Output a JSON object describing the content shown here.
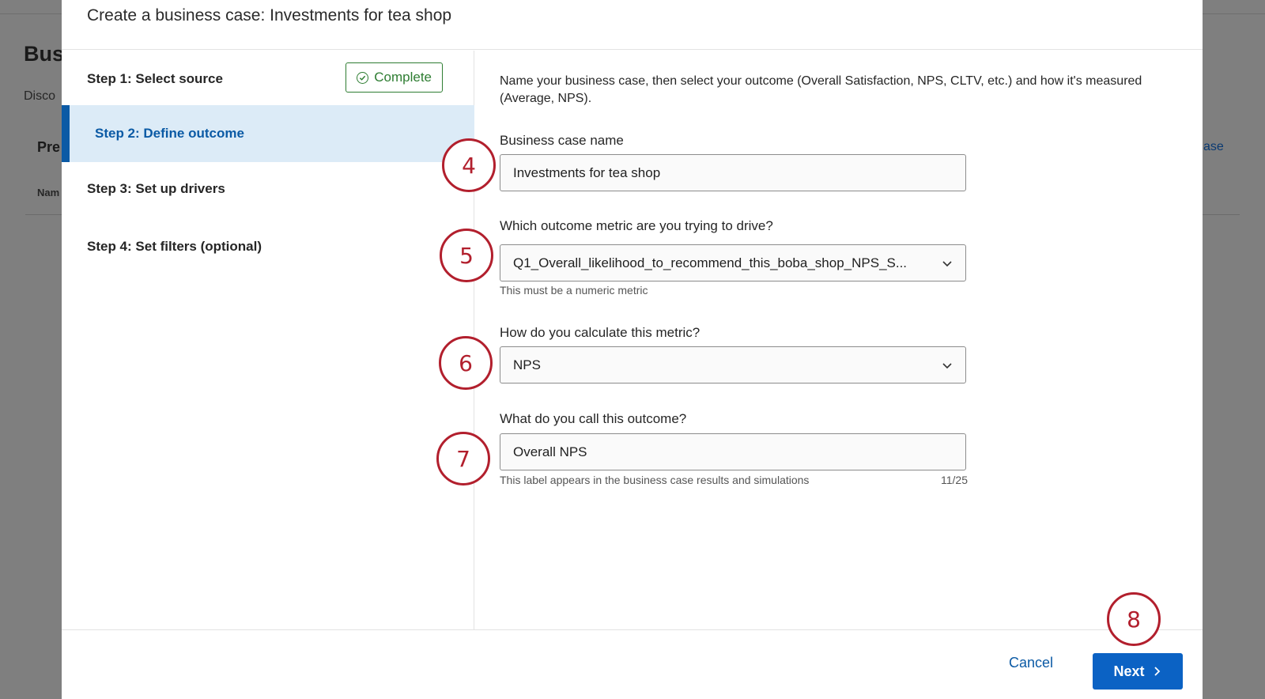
{
  "background": {
    "title": "Bus",
    "description": "Disco",
    "tab": "Pre",
    "column": "Nam",
    "link": "ase"
  },
  "modal": {
    "title": "Create a business case: Investments for tea shop",
    "steps": [
      {
        "label": "Step 1: Select source",
        "badge": "Complete",
        "state": "complete"
      },
      {
        "label": "Step 2: Define outcome",
        "state": "active"
      },
      {
        "label": "Step 3: Set up drivers",
        "state": "pending"
      },
      {
        "label": "Step 4: Set filters (optional)",
        "state": "pending"
      }
    ],
    "intro": "Name your business case, then select your outcome (Overall Satisfaction, NPS, CLTV, etc.) and how it's measured (Average, NPS).",
    "fields": {
      "name": {
        "label": "Business case name",
        "value": "Investments for tea shop"
      },
      "metric": {
        "label": "Which outcome metric are you trying to drive?",
        "value": "Q1_Overall_likelihood_to_recommend_this_boba_shop_NPS_S...",
        "helper": "This must be a numeric metric"
      },
      "calc": {
        "label": "How do you calculate this metric?",
        "value": "NPS"
      },
      "outcome": {
        "label": "What do you call this outcome?",
        "value": "Overall NPS",
        "helper": "This label appears in the business case results and simulations",
        "counter": "11/25"
      }
    },
    "footer": {
      "cancel": "Cancel",
      "next": "Next"
    }
  },
  "callouts": [
    "4",
    "5",
    "6",
    "7",
    "8"
  ],
  "colors": {
    "accent": "#0b62c4",
    "complete": "#2e7d32",
    "callout": "#b21f2d",
    "active_step_bg": "#dcebf7"
  }
}
